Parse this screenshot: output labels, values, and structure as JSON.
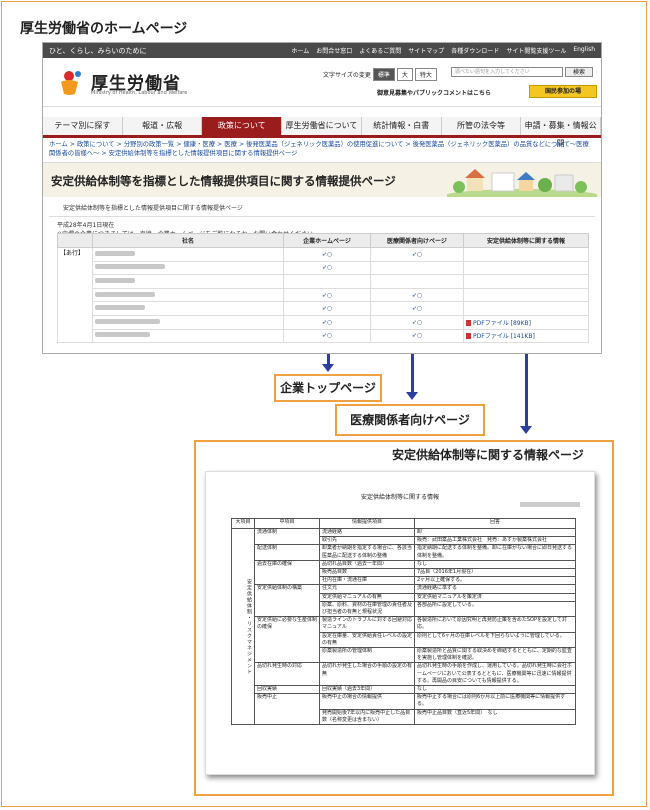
{
  "page_heading": "厚生労働省のホームページ",
  "site": {
    "tagline": "ひと、くらし、みらいのために",
    "toplinks": [
      "ホーム",
      "お問合せ窓口",
      "よくあるご質問",
      "サイトマップ",
      "各種ダウンロード",
      "サイト閲覧支援ツール",
      "English"
    ],
    "logo_text": "厚生労働省",
    "logo_sub": "Ministry of Health, Labour and Welfare",
    "fontsize_label": "文字サイズの変更",
    "fontsize_options": [
      "標準",
      "大",
      "特大"
    ],
    "search_placeholder": "調べたい語句を入力してください",
    "search_button": "検索",
    "pub_comment": "御意見募集やパブリックコメントはこちら",
    "sanka_button": "国民参加の場",
    "nav": [
      "テーマ別に探す",
      "報道・広報",
      "政策について",
      "厚生労働省について",
      "統計情報・白書",
      "所管の法令等",
      "申請・募集・情報公開"
    ],
    "breadcrumb": "ホーム > 政策について > 分野別の政策一覧 > 健康・医療 > 医療 > 後発医薬品（ジェネリック医薬品）の使用促進について > 後発医薬品（ジェネリック医薬品）の品質などについて～医療関係者の皆様へ～ > 安定供給体制等を指標とした情報提供項目に関する情報提供ページ",
    "title": "安定供給体制等を指標とした情報提供項目に関する情報提供ページ",
    "sub_title": "安定供給体制等を指標とした情報提供項目に関する情報提供ページ",
    "note1": "平成28年4月1日現在",
    "note2": "※空欄の企業につきましては，直接，企業ホームページをご覧になるか，お問い合わせください。",
    "table_headers": [
      "社名",
      "企業ホームページ",
      "医療関係者向けページ",
      "安定供給体制等に関する情報"
    ],
    "group_label": "【あ行】",
    "link_glyph": "○",
    "pdf_labels": [
      "PDFファイル [89KB]",
      "PDFファイル [141KB]"
    ]
  },
  "callouts": {
    "company_top": "企業トップページ",
    "medical_page": "医療関係者向けページ",
    "supply_info": "安定供給体制等に関する情報ページ"
  },
  "doc": {
    "title": "安定供給体制等に関する情報",
    "headers": [
      "大項目",
      "中項目",
      "情報提供項目",
      "回答"
    ],
    "major_item": "安定供給体制・リスクマネジメント",
    "rows": [
      [
        "流通体制",
        "流通経路",
        "卸"
      ],
      [
        "",
        "取引先",
        "販売：武田薬品工業株式会社　発売：あすか製薬株式会社"
      ],
      [
        "配送体制",
        "卸業者が納期を指定する場合に、各該当医薬品に配送する体制の整備",
        "指定納期に配送する体制を整備。卸に在庫がない場合に即日発送する体制を整備。"
      ],
      [
        "過去在庫の確保",
        "品切れ品目数（過去一年間）",
        "なし"
      ],
      [
        "",
        "販売品目数",
        "7品目（2016年1月現在）"
      ],
      [
        "",
        "社内在庫・流通在庫",
        "2ヶ月以上確保する。"
      ],
      [
        "安定供給体制の構築",
        "住文元",
        "流通経路に準ずる"
      ],
      [
        "",
        "安定供給マニュアルの有無",
        "安定供給マニュアルを策定済"
      ],
      [
        "",
        "原薬、原料、資材の在庫管理の責任者及び担当者の有無と規程状況",
        "各部品所に設定している。"
      ],
      [
        "安定供給に必要な生産体制の確保",
        "製造ラインのトラブルに対する回避対応マニュアル",
        "各製造所において原因究明と再発防止策を含めたSOPを設定して対応。"
      ],
      [
        "",
        "設定在庫量、安定供給責任レベルの設定の有無",
        "原則として6ヶ月の在庫レベルを下回らないように管理している。"
      ],
      [
        "",
        "原薬製造所の管理体制",
        "原薬製造所と品質に関する取決めを締結するとともに、定期的な監査を実施し管理体制を確認。"
      ],
      [
        "品切れ発生時の対応",
        "品切れが発生した場合の手順の設定の有無",
        "品切れ発生時の手順を作成し、運用している。品切れ発生時に会社ホームページにおいて公表するとともに、医療機関等に迅速に情報提供する。再開品の目安についても情報提供する。"
      ],
      [
        "回収実績",
        "回収実績（過去3年間）",
        "なし"
      ],
      [
        "販売中止",
        "販売中止の場合の情報提供",
        "販売中止する場合には原則6か月以上前に医療機関等に情報提供する。"
      ],
      [
        "",
        "発売開始後7年以内に販売中止した品目数（名称変更は含まない）",
        "販売中止品目数（直近5年間）　なし"
      ]
    ]
  }
}
